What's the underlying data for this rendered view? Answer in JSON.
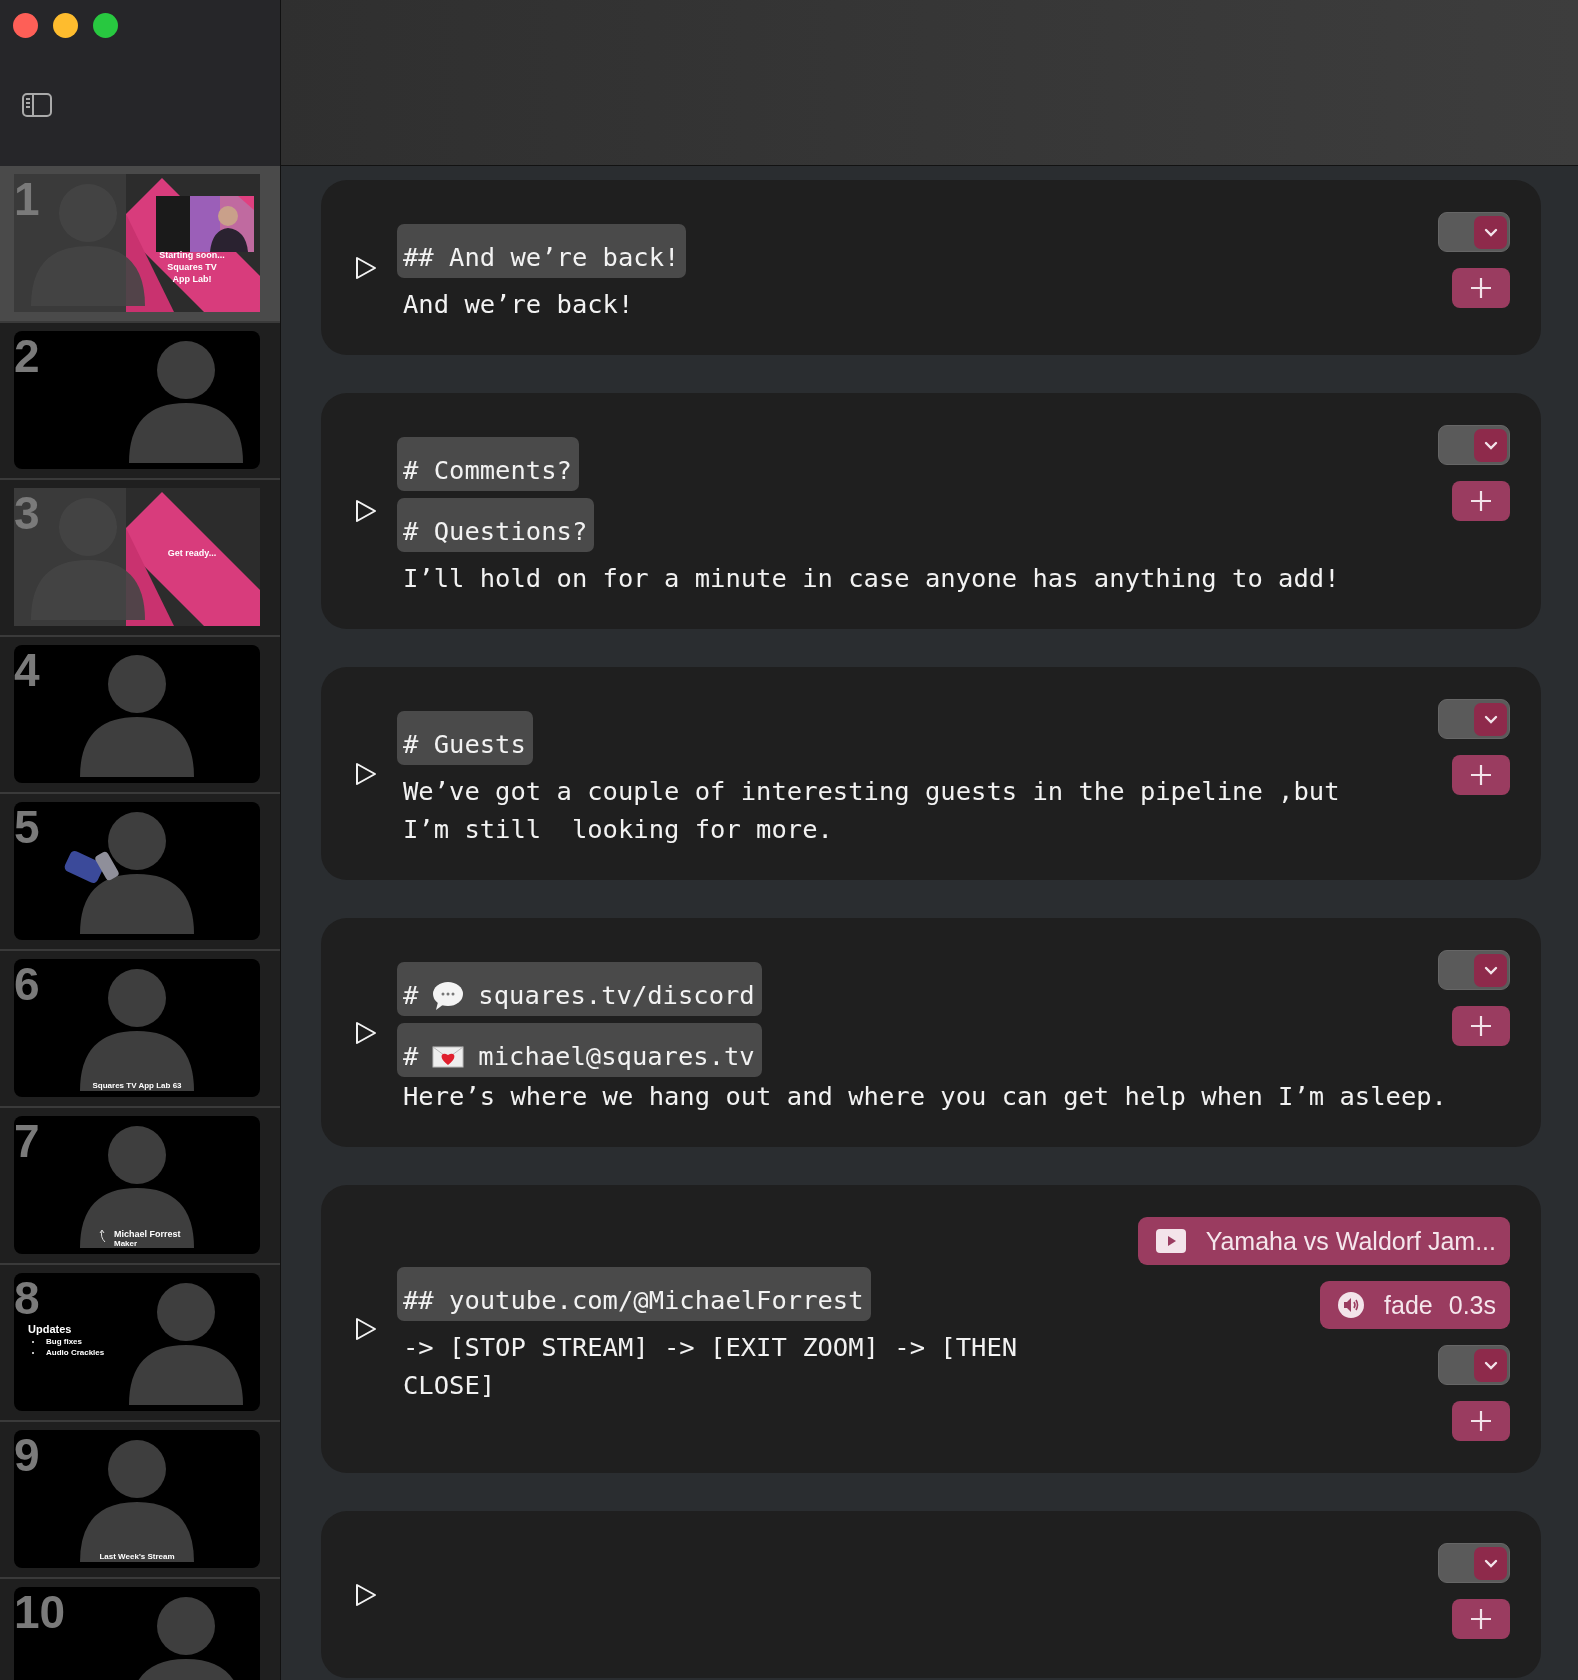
{
  "sidebar": {
    "slides": [
      {
        "number": "1",
        "selected": true,
        "kind": "branded",
        "screenshot": true,
        "caption": {
          "kind": "title-card",
          "lines": [
            "Starting soon...",
            "Squares TV",
            "App Lab!"
          ]
        }
      },
      {
        "number": "2",
        "selected": false,
        "kind": "offset"
      },
      {
        "number": "3",
        "selected": false,
        "kind": "branded",
        "caption": {
          "kind": "title-card",
          "lines": [
            "Get ready..."
          ]
        }
      },
      {
        "number": "4",
        "selected": false,
        "kind": "centered"
      },
      {
        "number": "5",
        "selected": false,
        "kind": "centered",
        "object": true
      },
      {
        "number": "6",
        "selected": false,
        "kind": "centered",
        "caption": {
          "kind": "footer",
          "lines": [
            "Squares TV App Lab 63"
          ]
        }
      },
      {
        "number": "7",
        "selected": false,
        "kind": "centered",
        "caption": {
          "kind": "lower-third",
          "lines": [
            "Michael Forrest",
            "Maker"
          ]
        }
      },
      {
        "number": "8",
        "selected": false,
        "kind": "offset",
        "caption": {
          "kind": "bullets",
          "lines": [
            "Updates",
            "Bug fixes",
            "Audio Crackles"
          ]
        }
      },
      {
        "number": "9",
        "selected": false,
        "kind": "centered",
        "caption": {
          "kind": "footer",
          "lines": [
            "Last Week’s Stream"
          ]
        }
      },
      {
        "number": "10",
        "selected": false,
        "kind": "offset"
      }
    ]
  },
  "cards": [
    {
      "toggle_on": true,
      "headings": [
        {
          "text": "## And we’re back!"
        }
      ],
      "body": [
        "And we’re back!"
      ]
    },
    {
      "toggle_on": true,
      "headings": [
        {
          "text": "# Comments?"
        },
        {
          "text": "# Questions?"
        }
      ],
      "body": [
        "I’ll hold on for a minute in case anyone has anything to add!"
      ]
    },
    {
      "toggle_on": true,
      "headings": [
        {
          "text": "# Guests"
        }
      ],
      "body": [
        "We’ve got a couple of interesting guests in the pipeline ,but",
        "I’m still  looking for more."
      ]
    },
    {
      "toggle_on": true,
      "headings": [
        {
          "prefix": "#",
          "kind": "chat",
          "text": "squares.tv/discord"
        },
        {
          "prefix": "#",
          "kind": "mail",
          "text": "michael@squares.tv"
        }
      ],
      "body": [
        "Here’s where we hang out and where you can get help when I’m asleep."
      ]
    },
    {
      "toggle_on": true,
      "headings": [
        {
          "text": "## youtube.com/@MichaelForrest"
        }
      ],
      "body": [
        "-> [STOP STREAM] -> [EXIT ZOOM] -> [THEN",
        "CLOSE]"
      ],
      "media": [
        {
          "kind": "video",
          "label": "Yamaha vs Waldorf Jam..."
        },
        {
          "kind": "audio",
          "label": "fade",
          "value": "0.3s"
        }
      ]
    },
    {
      "toggle_on": true
    }
  ]
}
